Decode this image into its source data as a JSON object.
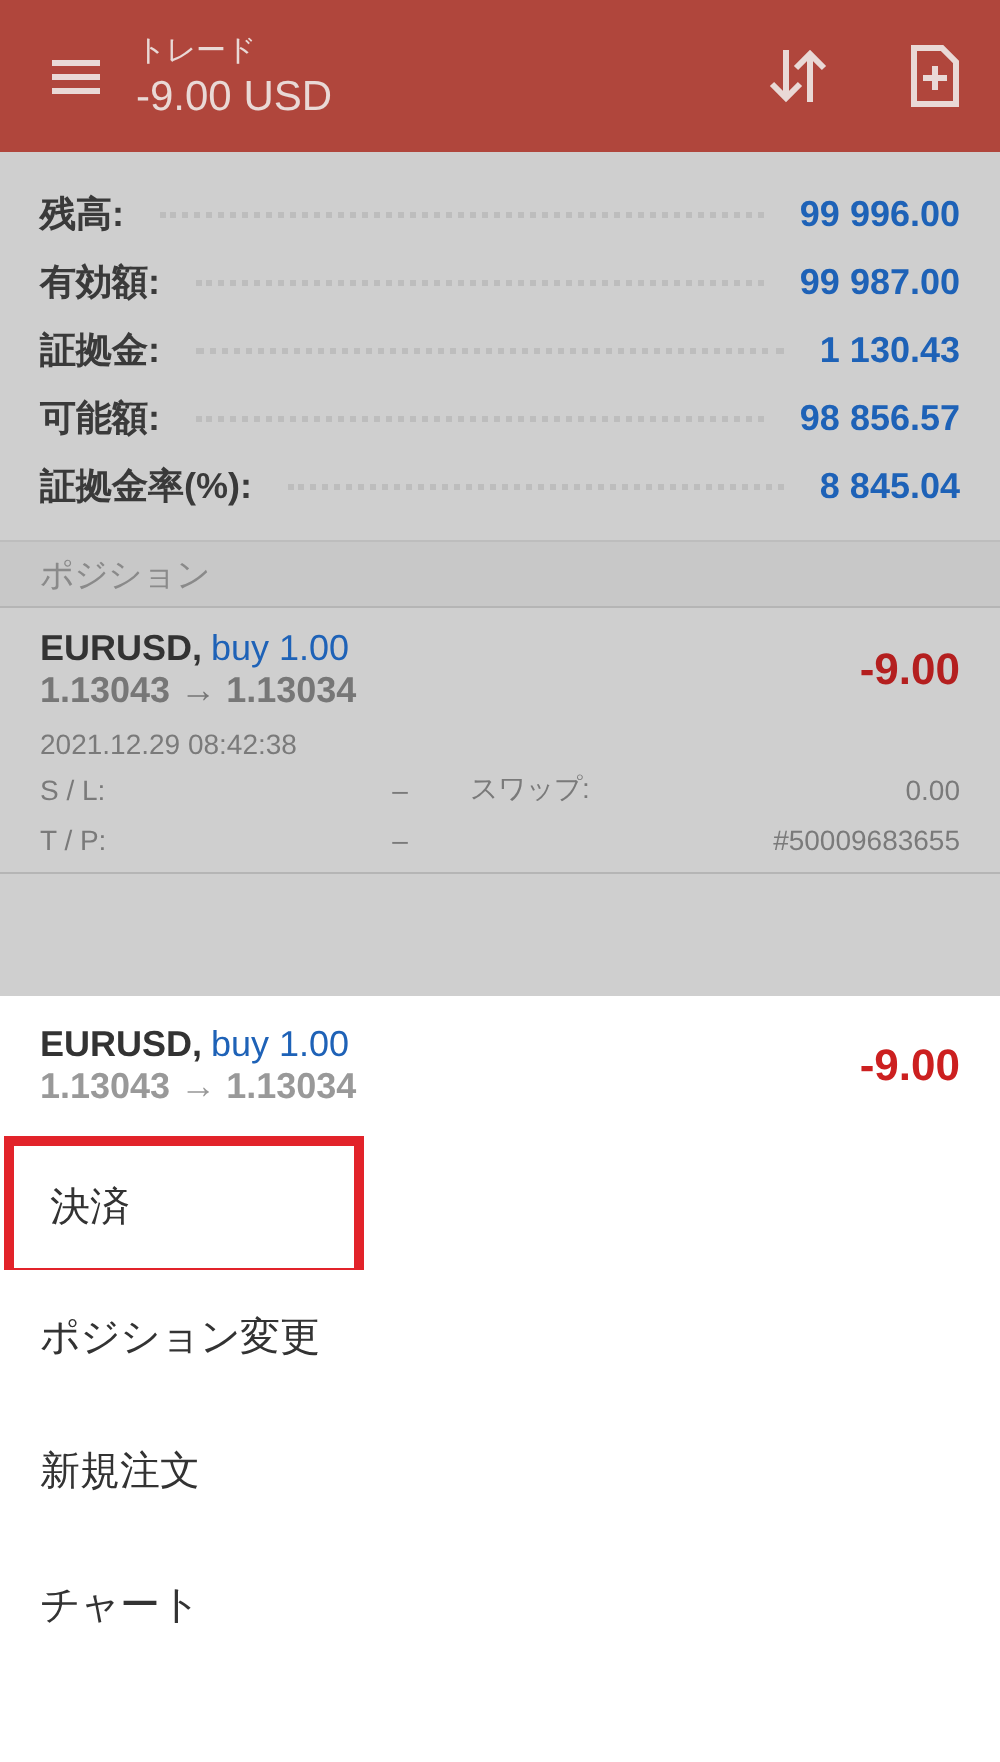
{
  "app_bar": {
    "title": "トレード",
    "subtitle": "-9.00 USD"
  },
  "summary": [
    {
      "label": "残高:",
      "value": "99 996.00"
    },
    {
      "label": "有効額:",
      "value": "99 987.00"
    },
    {
      "label": "証拠金:",
      "value": "1 130.43"
    },
    {
      "label": "可能額:",
      "value": "98 856.57"
    },
    {
      "label": "証拠金率(%):",
      "value": "8 845.04"
    }
  ],
  "positions_header": "ポジション",
  "position": {
    "symbol": "EURUSD,",
    "side": "buy 1.00",
    "price": "1.13043 → 1.13034",
    "profit": "-9.00",
    "time": "2021.12.29 08:42:38",
    "sl_label": "S / L:",
    "sl_value": "–",
    "swap_label": "スワップ:",
    "swap_value": "0.00",
    "tp_label": "T / P:",
    "tp_value": "–",
    "ticket": "#50009683655"
  },
  "sheet": {
    "symbol": "EURUSD,",
    "side": "buy 1.00",
    "price": "1.13043 → 1.13034",
    "profit": "-9.00",
    "items": [
      {
        "label": "決済",
        "highlighted": true
      },
      {
        "label": "ポジション変更",
        "highlighted": false
      },
      {
        "label": "新規注文",
        "highlighted": false
      },
      {
        "label": "チャート",
        "highlighted": false
      }
    ]
  }
}
